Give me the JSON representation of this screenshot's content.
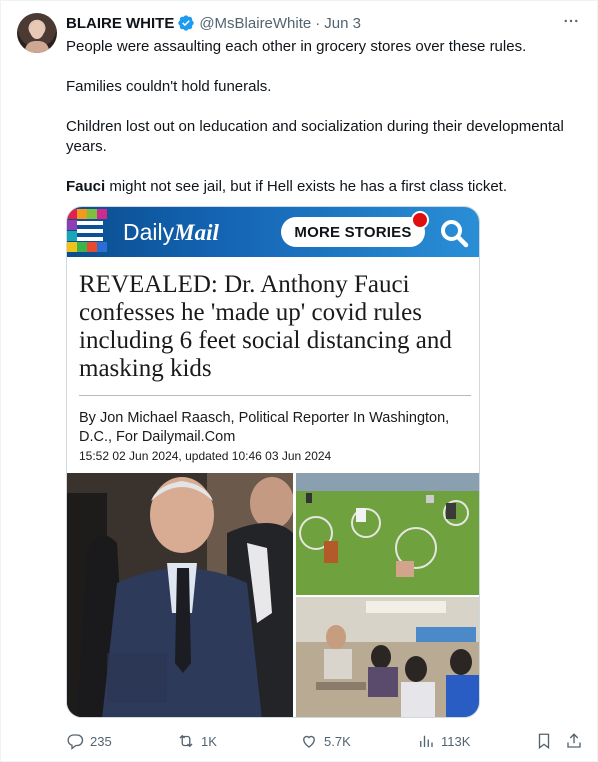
{
  "tweet": {
    "author_name": "BLAIRE WHITE",
    "handle": "@MsBlaireWhite",
    "separator": "·",
    "date": "Jun 3",
    "more_glyph": "···",
    "lines": [
      "People were assaulting each other in grocery stores over these rules.",
      "Families couldn't hold funerals.",
      "Children lost out on leducation and socialization during their developmental years."
    ],
    "last_line_bold": "Fauci",
    "last_line_rest": " might not see jail, but if Hell exists he has a first class ticket."
  },
  "article": {
    "brand_daily": "Daily",
    "brand_mail": "Mail",
    "more_stories_label": "MORE STORIES",
    "headline": "REVEALED: Dr. Anthony Fauci confesses he 'made up' covid rules including 6 feet social distancing and masking kids",
    "byline": "By Jon Michael Raasch, Political Reporter In Washington, D.C., For Dailymail.Com",
    "timestamp": "15:52 02 Jun 2024, updated 10:46 03 Jun 2024",
    "brand_colors": {
      "bar": "#1566b5",
      "dot": "#e10e10"
    }
  },
  "actions": {
    "replies": "235",
    "reposts": "1K",
    "likes": "5.7K",
    "views": "113K"
  },
  "icons": {
    "verified": "verified-badge-icon",
    "reply": "reply-icon",
    "repost": "repost-icon",
    "like": "heart-icon",
    "views": "views-icon",
    "bookmark": "bookmark-icon",
    "share": "share-icon"
  }
}
